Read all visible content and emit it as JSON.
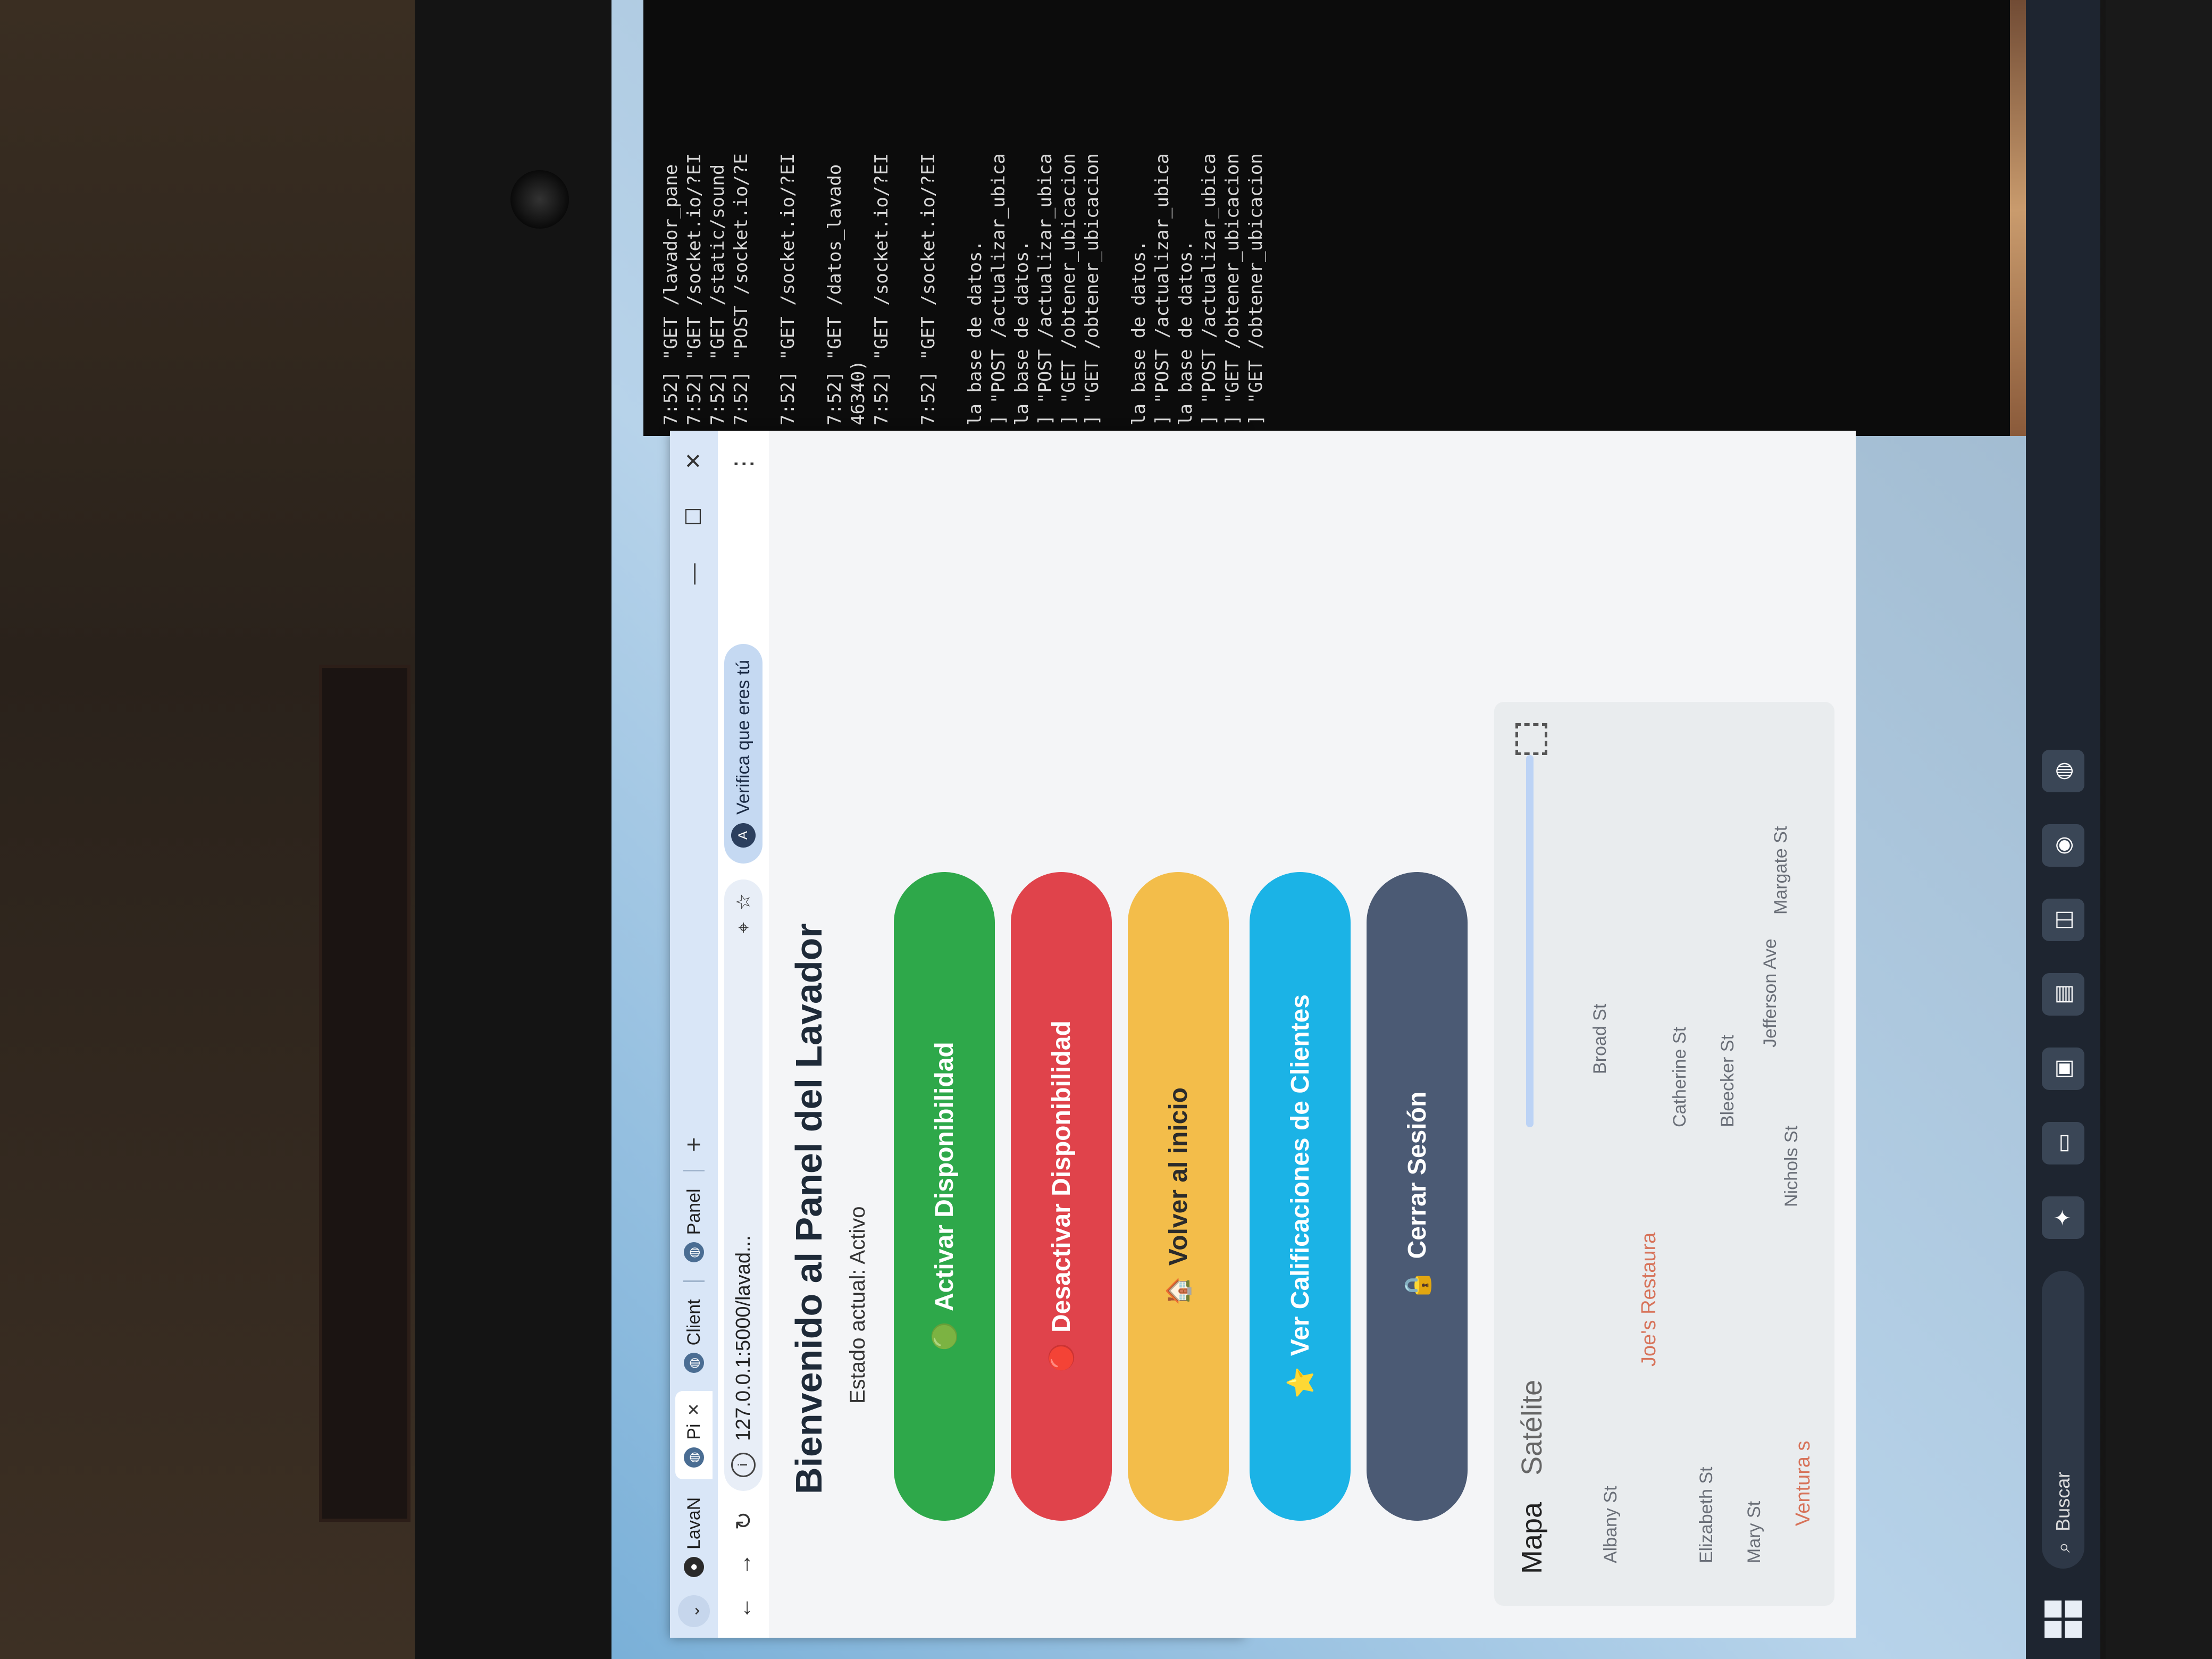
{
  "browser": {
    "tabs": [
      {
        "label": "LavaN",
        "active": false
      },
      {
        "label": "Pi",
        "active": true
      },
      {
        "label": "Client",
        "active": false
      },
      {
        "label": "Panel",
        "active": false
      }
    ],
    "new_tab": "+",
    "window_controls": {
      "minimize": "—",
      "maximize": "☐",
      "close": "✕"
    },
    "url": "127.0.0.1:5000/lavad...",
    "verify_chip": "Verifica que eres tú",
    "menu": "⋮"
  },
  "page": {
    "title": "Bienvenido al Panel del Lavador",
    "status": "Estado actual: Activo",
    "buttons": {
      "activate": "Activar Disponibilidad",
      "deactivate": "Desactivar Disponibilidad",
      "home": "Volver al inicio",
      "ratings": "Ver Calificaciones de Clientes",
      "logout": "Cerrar Sesión"
    },
    "icons": {
      "activate": "🟢",
      "deactivate": "🔴",
      "home": "🏠",
      "ratings": "⭐",
      "logout": "🔒"
    }
  },
  "map": {
    "tabs": [
      "Mapa",
      "Satélite"
    ],
    "streets": [
      "Albany St",
      "Elizabeth St",
      "Mary St",
      "Catherine St",
      "Broad St",
      "Bleecker St",
      "Nichols St",
      "Jefferson Ave",
      "Margate St"
    ],
    "pois": [
      "Joe's Restaura",
      "Ventura s"
    ]
  },
  "taskbar": {
    "search": "Buscar"
  },
  "terminal": {
    "lines": [
      "7:52] \"GET /lavador_pane",
      "7:52] \"GET /socket.io/?EI",
      "7:52] \"GET /static/sound",
      "7:52] \"POST /socket.io/?E",
      "",
      "7:52] \"GET /socket.io/?EI",
      "",
      "7:52] \"GET /datos_lavado",
      "46340)",
      "7:52] \"GET /socket.io/?EI",
      "",
      "7:52] \"GET /socket.io/?EI",
      "",
      "la base de datos.",
      "] \"POST /actualizar_ubica",
      "la base de datos.",
      "] \"POST /actualizar_ubica",
      "] \"GET /obtener_ubicacion",
      "] \"GET /obtener_ubicacion",
      "",
      "la base de datos.",
      "] \"POST /actualizar_ubica",
      "la base de datos.",
      "] \"POST /actualizar_ubica",
      "] \"GET /obtener_ubicacion",
      "] \"GET /obtener_ubicacion"
    ]
  }
}
